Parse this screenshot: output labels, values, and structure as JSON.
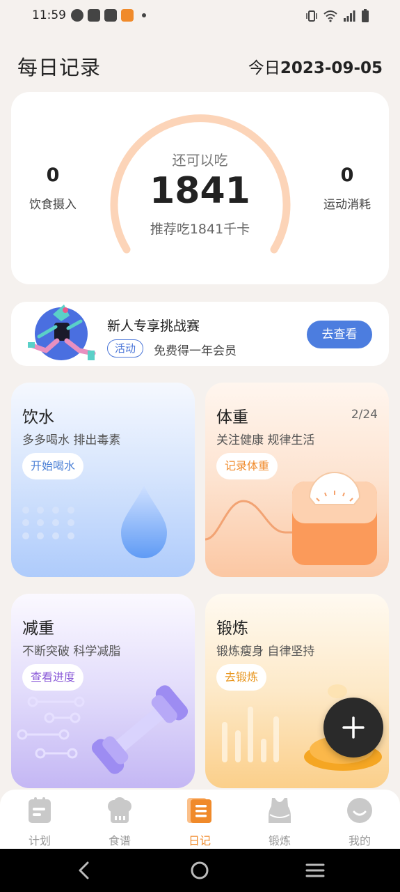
{
  "status_bar": {
    "time": "11:59"
  },
  "header": {
    "title": "每日记录",
    "today_prefix": "今日",
    "date": "2023-09-05"
  },
  "summary": {
    "intake_value": "0",
    "intake_label": "饮食摄入",
    "remaining_label": "还可以吃",
    "remaining_value": "1841",
    "recommend_text": "推荐吃1841千卡",
    "burn_value": "0",
    "burn_label": "运动消耗",
    "gauge_color": "#fcd4b8"
  },
  "challenge": {
    "title": "新人专享挑战赛",
    "tag": "活动",
    "desc": "免费得一年会员",
    "button": "去查看",
    "button_color": "#4c7ddf"
  },
  "cards": {
    "water": {
      "title": "饮水",
      "subtitle": "多多喝水 排出毒素",
      "button": "开始喝水",
      "accent": "#4a7fd6"
    },
    "weight": {
      "title": "体重",
      "subtitle": "关注健康 规律生活",
      "button": "记录体重",
      "count": "2/24",
      "accent": "#f08a2a"
    },
    "lose": {
      "title": "减重",
      "subtitle": "不断突破 科学减脂",
      "button": "查看进度",
      "accent": "#8a5ad8"
    },
    "exercise": {
      "title": "锻炼",
      "subtitle": "锻炼瘦身 自律坚持",
      "button": "去锻炼",
      "accent": "#e8951c"
    }
  },
  "tabs": [
    {
      "label": "计划",
      "icon": "plan-icon"
    },
    {
      "label": "食谱",
      "icon": "chef-hat-icon"
    },
    {
      "label": "日记",
      "icon": "diary-icon",
      "active": true
    },
    {
      "label": "锻炼",
      "icon": "tank-top-icon"
    },
    {
      "label": "我的",
      "icon": "smile-face-icon"
    }
  ]
}
